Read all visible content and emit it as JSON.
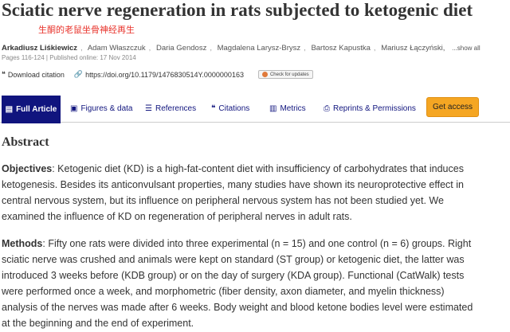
{
  "article": {
    "title": "Sciatic nerve regeneration in rats subjected to ketogenic diet",
    "annotation": "生酮的老鼠坐骨神经再生",
    "authors": [
      "Arkadiusz Liśkiewicz",
      "Adam Właszczuk",
      "Daria Gendosz",
      "Magdalena Larysz-Brysz",
      "Bartosz Kapustka",
      "Mariusz Łączyński,"
    ],
    "show_all": "...show all",
    "pub_info": "Pages 116-124 | Published online: 17 Nov 2014"
  },
  "links": {
    "download": "Download citation",
    "doi": "https://doi.org/10.1179/1476830514Y.0000000163",
    "check_updates": "Check for updates"
  },
  "nav": {
    "tabs": [
      "Full Article",
      "Figures & data",
      "References",
      "Citations",
      "Metrics",
      "Reprints & Permissions"
    ],
    "access": "Get access"
  },
  "abstract": {
    "heading": "Abstract",
    "objectives_label": "Objectives",
    "objectives_text": ": Ketogenic diet (KD) is a high-fat-content diet with insufficiency of carbohydrates that induces ketogenesis. Besides its anticonvulsant properties, many studies have shown its neuroprotective effect in central nervous system, but its influence on peripheral nervous system has not been studied yet. We examined the influence of KD on regeneration of peripheral nerves in adult rats.",
    "methods_label": "Methods",
    "methods_text": ": Fifty one rats were divided into three experimental (n = 15) and one control (n = 6) groups. Right sciatic nerve was crushed and animals were kept on standard (ST group) or ketogenic diet, the latter was introduced 3 weeks before (KDB group) or on the day of surgery (KDA group). Functional (CatWalk) tests were performed once a week, and morphometric (fiber density, axon diameter, and myelin thickness) analysis of the nerves was made after 6 weeks. Body weight and blood ketone bodies level were estimated at the beginning and the end of experiment."
  }
}
